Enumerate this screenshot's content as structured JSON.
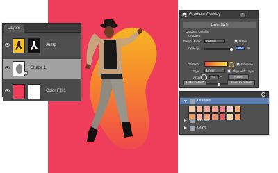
{
  "layers_panel": {
    "tab": "Layers",
    "layers": [
      {
        "name": "Jump"
      },
      {
        "name": "Shape 1"
      },
      {
        "name": "Color Fill 1"
      }
    ]
  },
  "gradient_panel": {
    "header": "Gradient Overlay",
    "add_label": "+",
    "layer_style_title": "Layer Style",
    "section_title": "Gradient Overlay",
    "section_sub": "Gradient",
    "blend_mode_label": "Blend Mode:",
    "blend_mode_value": "Normal",
    "dither_label": "Dither",
    "opacity_label": "Opacity:",
    "opacity_value": "100",
    "gradient_label": "Gradient:",
    "reverse_label": "Reverse",
    "style_label": "Style:",
    "style_value": "Linear",
    "align_label": "Align with Layer",
    "angle_label": "Angle:",
    "angle_value": "-90",
    "reset_alignment_label": "Reset Alignment",
    "scale_label": "Scale:",
    "scale_value": "100",
    "percent": "%",
    "degree": "°",
    "make_default_label": "Make Default",
    "reset_default_label": "Reset to Default"
  },
  "swatches_panel": {
    "groups": [
      {
        "name": "Oranges",
        "expanded": true
      },
      {
        "name": "Greens",
        "expanded": false
      },
      {
        "name": "Grays",
        "expanded": false
      }
    ],
    "swatch_colors": [
      [
        "#f6c9a8",
        "#f7b7a1",
        "#f2a39a",
        "#f39f8c",
        "#ec7b85",
        "#f6cdc6",
        "#f3b07c"
      ],
      [
        "#e9a06a",
        "#f2b39e",
        "#eaa184",
        "#e88e73",
        "#d85f66",
        "#f0d2ad",
        "#e6a072"
      ]
    ]
  },
  "colors": {
    "canvas_bg": "#ef3e5b",
    "blob": "#f3a52c",
    "panel": "#505050",
    "selection": "#5d7fb1"
  }
}
